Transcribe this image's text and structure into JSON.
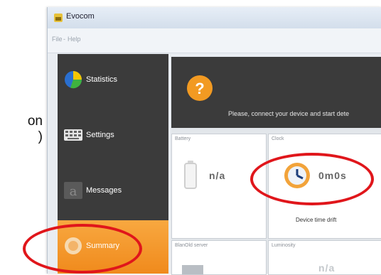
{
  "side_text": "on\n)",
  "window": {
    "title": "Evocom",
    "title_extra": "",
    "menu": [
      "File",
      "Help"
    ]
  },
  "sidebar": {
    "items": [
      {
        "label": "Statistics",
        "icon": "statistics-icon",
        "active": false
      },
      {
        "label": "Settings",
        "icon": "settings-icon",
        "active": false
      },
      {
        "label": "Messages",
        "icon": "messages-icon",
        "active": false
      },
      {
        "label": "Summary",
        "icon": "summary-icon",
        "active": true
      }
    ]
  },
  "banner": {
    "message": "Please, connect your device and start dete"
  },
  "cards": {
    "battery": {
      "title": "Battery",
      "value": "n/a"
    },
    "clock": {
      "title": "Clock",
      "value": "0m0s",
      "subtitle": "Device time drift"
    },
    "server": {
      "title": "BlanOld server"
    },
    "luminosity": {
      "title": "Luminosity",
      "value": "n/a"
    }
  },
  "colors": {
    "accent": "#f0901f",
    "sidebar_bg": "#3b3b3b",
    "highlight": "#e0161b"
  }
}
